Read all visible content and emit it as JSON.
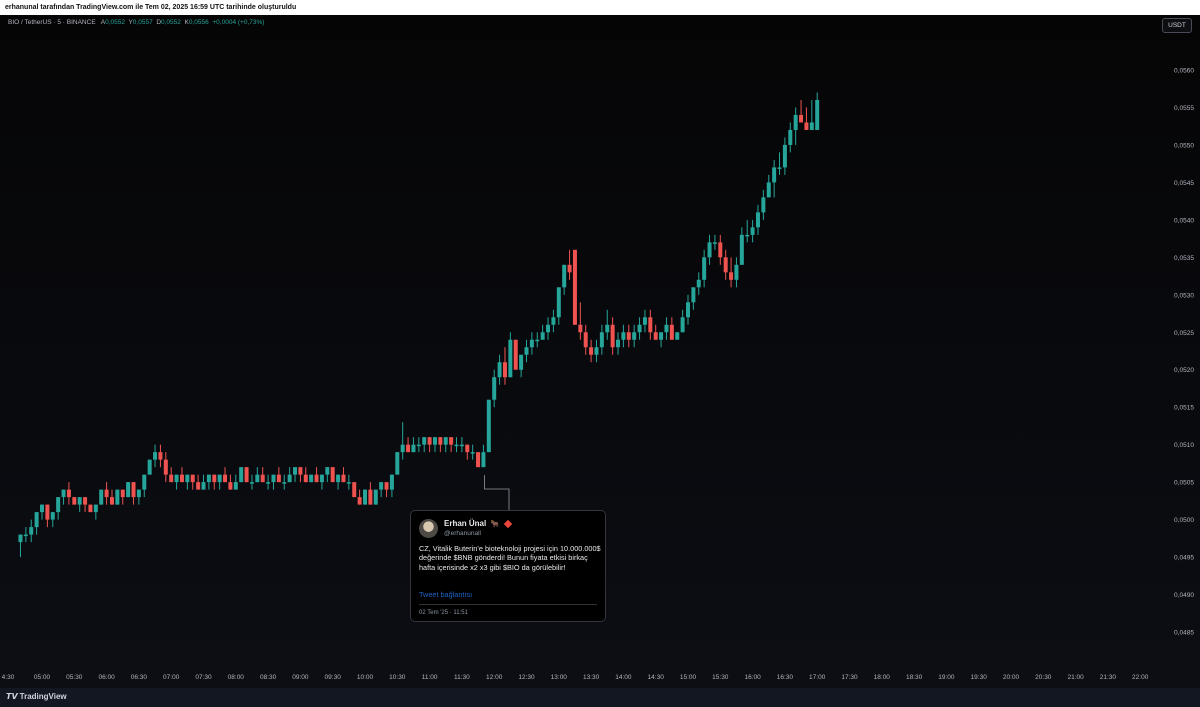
{
  "header": {
    "title": "erhanunal tarafından TradingView.com ile Tem 02, 2025 16:59 UTC tarihinde oluşturuldu"
  },
  "symbol": {
    "name": "BIO / TetherUS · 5 · BINANCE",
    "open_label": "A",
    "open": "0,0552",
    "high_label": "Y",
    "high": "0,0557",
    "low_label": "D",
    "low": "0,0552",
    "close_label": "K",
    "close": "0,0556",
    "change": "+0,0004 (+0,73%)"
  },
  "currency_button": "USDT",
  "colors": {
    "up": "#26a69a",
    "down": "#ef5350",
    "bg": "#0b0c10",
    "text": "#d1d4dc"
  },
  "price_axis": [
    "0,0560",
    "0,0555",
    "0,0550",
    "0,0545",
    "0,0540",
    "0,0535",
    "0,0530",
    "0,0525",
    "0,0520",
    "0,0515",
    "0,0510",
    "0,0505",
    "0,0500",
    "0,0495",
    "0,0490",
    "0,0485"
  ],
  "time_axis": [
    "4:30",
    "05:00",
    "05:30",
    "06:00",
    "06:30",
    "07:00",
    "07:30",
    "08:00",
    "08:30",
    "09:00",
    "09:30",
    "10:00",
    "10:30",
    "11:00",
    "11:30",
    "12:00",
    "12:30",
    "13:00",
    "13:30",
    "14:00",
    "14:30",
    "15:00",
    "15:30",
    "16:00",
    "16:30",
    "17:00",
    "17:30",
    "18:00",
    "18:30",
    "19:00",
    "19:30",
    "20:00",
    "20:30",
    "21:00",
    "21:30",
    "22:00"
  ],
  "tweet": {
    "name": "Erhan Ünal",
    "name_emoji": "🐂",
    "handle": "@erhanunall",
    "text": "CZ, Vitalik Buterin’e bioteknoloji projesi için 10.000.000$ değerinde $BNB gönderdi! Bunun fiyata etkisi birkaç hafta içerisinde x2 x3 gibi $BIO da görülebilir!",
    "link": "Tweet bağlantısı",
    "date": "02 Tem '25 · 11:51"
  },
  "footer": {
    "logo": "TradingView",
    "logo_mark": "𝙏𝙑"
  },
  "chart_data": {
    "type": "candlestick",
    "interval": "5",
    "series": [
      {
        "t": "04:40",
        "o": 0.0497,
        "h": 0.0498,
        "l": 0.0495,
        "c": 0.0498
      },
      {
        "t": "04:45",
        "o": 0.0498,
        "h": 0.0499,
        "l": 0.0497,
        "c": 0.0498
      },
      {
        "t": "04:50",
        "o": 0.0498,
        "h": 0.05,
        "l": 0.0497,
        "c": 0.0499
      },
      {
        "t": "04:55",
        "o": 0.0499,
        "h": 0.0501,
        "l": 0.0498,
        "c": 0.0501
      },
      {
        "t": "05:00",
        "o": 0.0501,
        "h": 0.0502,
        "l": 0.05,
        "c": 0.0502
      },
      {
        "t": "05:05",
        "o": 0.0502,
        "h": 0.0502,
        "l": 0.0499,
        "c": 0.05
      },
      {
        "t": "05:10",
        "o": 0.05,
        "h": 0.0501,
        "l": 0.0499,
        "c": 0.0501
      },
      {
        "t": "05:15",
        "o": 0.0501,
        "h": 0.0503,
        "l": 0.05,
        "c": 0.0503
      },
      {
        "t": "05:20",
        "o": 0.0503,
        "h": 0.0504,
        "l": 0.0502,
        "c": 0.0504
      },
      {
        "t": "05:25",
        "o": 0.0504,
        "h": 0.0505,
        "l": 0.0502,
        "c": 0.0503
      },
      {
        "t": "05:30",
        "o": 0.0503,
        "h": 0.0503,
        "l": 0.0502,
        "c": 0.0502
      },
      {
        "t": "05:35",
        "o": 0.0502,
        "h": 0.0503,
        "l": 0.0501,
        "c": 0.0503
      },
      {
        "t": "05:40",
        "o": 0.0503,
        "h": 0.0503,
        "l": 0.0501,
        "c": 0.0502
      },
      {
        "t": "05:45",
        "o": 0.0502,
        "h": 0.0502,
        "l": 0.0501,
        "c": 0.0501
      },
      {
        "t": "05:50",
        "o": 0.0501,
        "h": 0.0502,
        "l": 0.05,
        "c": 0.0502
      },
      {
        "t": "05:55",
        "o": 0.0502,
        "h": 0.0504,
        "l": 0.0502,
        "c": 0.0504
      },
      {
        "t": "06:00",
        "o": 0.0504,
        "h": 0.0505,
        "l": 0.0502,
        "c": 0.0503
      },
      {
        "t": "06:05",
        "o": 0.0503,
        "h": 0.0504,
        "l": 0.0502,
        "c": 0.0502
      },
      {
        "t": "06:10",
        "o": 0.0502,
        "h": 0.0504,
        "l": 0.0502,
        "c": 0.0504
      },
      {
        "t": "06:15",
        "o": 0.0504,
        "h": 0.0504,
        "l": 0.0502,
        "c": 0.0503
      },
      {
        "t": "06:20",
        "o": 0.0503,
        "h": 0.0505,
        "l": 0.0503,
        "c": 0.0505
      },
      {
        "t": "06:25",
        "o": 0.0505,
        "h": 0.0505,
        "l": 0.0502,
        "c": 0.0503
      },
      {
        "t": "06:30",
        "o": 0.0503,
        "h": 0.0504,
        "l": 0.0502,
        "c": 0.0504
      },
      {
        "t": "06:35",
        "o": 0.0504,
        "h": 0.0506,
        "l": 0.0503,
        "c": 0.0506
      },
      {
        "t": "06:40",
        "o": 0.0506,
        "h": 0.0508,
        "l": 0.0506,
        "c": 0.0508
      },
      {
        "t": "06:45",
        "o": 0.0508,
        "h": 0.051,
        "l": 0.0507,
        "c": 0.0509
      },
      {
        "t": "06:50",
        "o": 0.0509,
        "h": 0.051,
        "l": 0.0507,
        "c": 0.0508
      },
      {
        "t": "06:55",
        "o": 0.0508,
        "h": 0.0509,
        "l": 0.0505,
        "c": 0.0506
      },
      {
        "t": "07:00",
        "o": 0.0506,
        "h": 0.0507,
        "l": 0.0505,
        "c": 0.0505
      },
      {
        "t": "07:05",
        "o": 0.0505,
        "h": 0.0506,
        "l": 0.0504,
        "c": 0.0506
      },
      {
        "t": "07:10",
        "o": 0.0506,
        "h": 0.0507,
        "l": 0.0505,
        "c": 0.0505
      },
      {
        "t": "07:15",
        "o": 0.0505,
        "h": 0.0506,
        "l": 0.0504,
        "c": 0.0506
      },
      {
        "t": "07:20",
        "o": 0.0506,
        "h": 0.0506,
        "l": 0.0504,
        "c": 0.0505
      },
      {
        "t": "07:25",
        "o": 0.0505,
        "h": 0.0506,
        "l": 0.0504,
        "c": 0.0504
      },
      {
        "t": "07:30",
        "o": 0.0504,
        "h": 0.0506,
        "l": 0.0504,
        "c": 0.0505
      },
      {
        "t": "07:35",
        "o": 0.0505,
        "h": 0.0506,
        "l": 0.0504,
        "c": 0.0506
      },
      {
        "t": "07:40",
        "o": 0.0506,
        "h": 0.0506,
        "l": 0.0504,
        "c": 0.0505
      },
      {
        "t": "07:45",
        "o": 0.0505,
        "h": 0.0506,
        "l": 0.0504,
        "c": 0.0506
      },
      {
        "t": "07:50",
        "o": 0.0506,
        "h": 0.0507,
        "l": 0.0505,
        "c": 0.0505
      },
      {
        "t": "07:55",
        "o": 0.0505,
        "h": 0.0506,
        "l": 0.0504,
        "c": 0.0504
      },
      {
        "t": "08:00",
        "o": 0.0504,
        "h": 0.0506,
        "l": 0.0504,
        "c": 0.0505
      },
      {
        "t": "08:05",
        "o": 0.0505,
        "h": 0.0507,
        "l": 0.0505,
        "c": 0.0507
      },
      {
        "t": "08:10",
        "o": 0.0507,
        "h": 0.0507,
        "l": 0.0505,
        "c": 0.0505
      },
      {
        "t": "08:15",
        "o": 0.0505,
        "h": 0.0506,
        "l": 0.0504,
        "c": 0.0505
      },
      {
        "t": "08:20",
        "o": 0.0505,
        "h": 0.0507,
        "l": 0.0505,
        "c": 0.0506
      },
      {
        "t": "08:25",
        "o": 0.0506,
        "h": 0.0507,
        "l": 0.0505,
        "c": 0.0505
      },
      {
        "t": "08:30",
        "o": 0.0505,
        "h": 0.0506,
        "l": 0.0504,
        "c": 0.0505
      },
      {
        "t": "08:35",
        "o": 0.0505,
        "h": 0.0506,
        "l": 0.0504,
        "c": 0.0506
      },
      {
        "t": "08:40",
        "o": 0.0506,
        "h": 0.0507,
        "l": 0.0505,
        "c": 0.0505
      },
      {
        "t": "08:45",
        "o": 0.0505,
        "h": 0.0506,
        "l": 0.0504,
        "c": 0.0505
      },
      {
        "t": "08:50",
        "o": 0.0505,
        "h": 0.0507,
        "l": 0.0505,
        "c": 0.0506
      },
      {
        "t": "08:55",
        "o": 0.0506,
        "h": 0.0507,
        "l": 0.0505,
        "c": 0.0507
      },
      {
        "t": "09:00",
        "o": 0.0507,
        "h": 0.0507,
        "l": 0.0505,
        "c": 0.0506
      },
      {
        "t": "09:05",
        "o": 0.0506,
        "h": 0.0507,
        "l": 0.0505,
        "c": 0.0505
      },
      {
        "t": "09:10",
        "o": 0.0505,
        "h": 0.0506,
        "l": 0.0505,
        "c": 0.0506
      },
      {
        "t": "09:15",
        "o": 0.0506,
        "h": 0.0507,
        "l": 0.0505,
        "c": 0.0505
      },
      {
        "t": "09:20",
        "o": 0.0505,
        "h": 0.0506,
        "l": 0.0504,
        "c": 0.0506
      },
      {
        "t": "09:25",
        "o": 0.0506,
        "h": 0.0507,
        "l": 0.0505,
        "c": 0.0507
      },
      {
        "t": "09:30",
        "o": 0.0507,
        "h": 0.0507,
        "l": 0.0505,
        "c": 0.0505
      },
      {
        "t": "09:35",
        "o": 0.0505,
        "h": 0.0506,
        "l": 0.0504,
        "c": 0.0506
      },
      {
        "t": "09:40",
        "o": 0.0506,
        "h": 0.0507,
        "l": 0.0505,
        "c": 0.0505
      },
      {
        "t": "09:45",
        "o": 0.0505,
        "h": 0.0506,
        "l": 0.0504,
        "c": 0.0505
      },
      {
        "t": "09:50",
        "o": 0.0505,
        "h": 0.0505,
        "l": 0.0503,
        "c": 0.0503
      },
      {
        "t": "09:55",
        "o": 0.0503,
        "h": 0.0504,
        "l": 0.0502,
        "c": 0.0502
      },
      {
        "t": "10:00",
        "o": 0.0502,
        "h": 0.0504,
        "l": 0.0502,
        "c": 0.0504
      },
      {
        "t": "10:05",
        "o": 0.0504,
        "h": 0.0505,
        "l": 0.0502,
        "c": 0.0502
      },
      {
        "t": "10:10",
        "o": 0.0502,
        "h": 0.0504,
        "l": 0.0502,
        "c": 0.0504
      },
      {
        "t": "10:15",
        "o": 0.0504,
        "h": 0.0505,
        "l": 0.0503,
        "c": 0.0505
      },
      {
        "t": "10:20",
        "o": 0.0505,
        "h": 0.0505,
        "l": 0.0503,
        "c": 0.0504
      },
      {
        "t": "10:25",
        "o": 0.0504,
        "h": 0.0506,
        "l": 0.0503,
        "c": 0.0506
      },
      {
        "t": "10:30",
        "o": 0.0506,
        "h": 0.0509,
        "l": 0.0506,
        "c": 0.0509
      },
      {
        "t": "10:35",
        "o": 0.0509,
        "h": 0.0513,
        "l": 0.0508,
        "c": 0.051
      },
      {
        "t": "10:40",
        "o": 0.051,
        "h": 0.0511,
        "l": 0.0509,
        "c": 0.0509
      },
      {
        "t": "10:45",
        "o": 0.0509,
        "h": 0.0511,
        "l": 0.0509,
        "c": 0.051
      },
      {
        "t": "10:50",
        "o": 0.051,
        "h": 0.0511,
        "l": 0.0509,
        "c": 0.051
      },
      {
        "t": "10:55",
        "o": 0.051,
        "h": 0.0511,
        "l": 0.0509,
        "c": 0.0511
      },
      {
        "t": "11:00",
        "o": 0.0511,
        "h": 0.0511,
        "l": 0.0509,
        "c": 0.051
      },
      {
        "t": "11:05",
        "o": 0.051,
        "h": 0.0511,
        "l": 0.0509,
        "c": 0.0511
      },
      {
        "t": "11:10",
        "o": 0.0511,
        "h": 0.0511,
        "l": 0.0509,
        "c": 0.051
      },
      {
        "t": "11:15",
        "o": 0.051,
        "h": 0.0511,
        "l": 0.0509,
        "c": 0.0511
      },
      {
        "t": "11:20",
        "o": 0.0511,
        "h": 0.0511,
        "l": 0.0509,
        "c": 0.051
      },
      {
        "t": "11:25",
        "o": 0.051,
        "h": 0.0511,
        "l": 0.0509,
        "c": 0.051
      },
      {
        "t": "11:30",
        "o": 0.051,
        "h": 0.0511,
        "l": 0.0509,
        "c": 0.051
      },
      {
        "t": "11:35",
        "o": 0.051,
        "h": 0.051,
        "l": 0.0508,
        "c": 0.0509
      },
      {
        "t": "11:40",
        "o": 0.0509,
        "h": 0.051,
        "l": 0.0508,
        "c": 0.0509
      },
      {
        "t": "11:45",
        "o": 0.0509,
        "h": 0.0509,
        "l": 0.0507,
        "c": 0.0507
      },
      {
        "t": "11:50",
        "o": 0.0507,
        "h": 0.051,
        "l": 0.0507,
        "c": 0.0509
      },
      {
        "t": "11:55",
        "o": 0.0509,
        "h": 0.0516,
        "l": 0.0509,
        "c": 0.0516
      },
      {
        "t": "12:00",
        "o": 0.0516,
        "h": 0.052,
        "l": 0.0515,
        "c": 0.0519
      },
      {
        "t": "12:05",
        "o": 0.0519,
        "h": 0.0522,
        "l": 0.0518,
        "c": 0.0521
      },
      {
        "t": "12:10",
        "o": 0.0521,
        "h": 0.0523,
        "l": 0.0518,
        "c": 0.0519
      },
      {
        "t": "12:15",
        "o": 0.0519,
        "h": 0.0525,
        "l": 0.0519,
        "c": 0.0524
      },
      {
        "t": "12:20",
        "o": 0.0524,
        "h": 0.0524,
        "l": 0.052,
        "c": 0.052
      },
      {
        "t": "12:25",
        "o": 0.052,
        "h": 0.0522,
        "l": 0.0519,
        "c": 0.0522
      },
      {
        "t": "12:30",
        "o": 0.0522,
        "h": 0.0524,
        "l": 0.0521,
        "c": 0.0523
      },
      {
        "t": "12:35",
        "o": 0.0523,
        "h": 0.0525,
        "l": 0.0522,
        "c": 0.0524
      },
      {
        "t": "12:40",
        "o": 0.0524,
        "h": 0.0525,
        "l": 0.0523,
        "c": 0.0524
      },
      {
        "t": "12:45",
        "o": 0.0524,
        "h": 0.0526,
        "l": 0.0524,
        "c": 0.0525
      },
      {
        "t": "12:50",
        "o": 0.0525,
        "h": 0.0527,
        "l": 0.0524,
        "c": 0.0526
      },
      {
        "t": "12:55",
        "o": 0.0526,
        "h": 0.0528,
        "l": 0.0525,
        "c": 0.0527
      },
      {
        "t": "13:00",
        "o": 0.0527,
        "h": 0.0531,
        "l": 0.0526,
        "c": 0.0531
      },
      {
        "t": "13:05",
        "o": 0.0531,
        "h": 0.0534,
        "l": 0.053,
        "c": 0.0534
      },
      {
        "t": "13:10",
        "o": 0.0534,
        "h": 0.0536,
        "l": 0.0532,
        "c": 0.0533
      },
      {
        "t": "13:15",
        "o": 0.0536,
        "h": 0.0536,
        "l": 0.0526,
        "c": 0.0526
      },
      {
        "t": "13:20",
        "o": 0.0526,
        "h": 0.0529,
        "l": 0.0524,
        "c": 0.0525
      },
      {
        "t": "13:25",
        "o": 0.0525,
        "h": 0.0526,
        "l": 0.0522,
        "c": 0.0523
      },
      {
        "t": "13:30",
        "o": 0.0523,
        "h": 0.0524,
        "l": 0.0521,
        "c": 0.0522
      },
      {
        "t": "13:35",
        "o": 0.0522,
        "h": 0.0524,
        "l": 0.0521,
        "c": 0.0523
      },
      {
        "t": "13:40",
        "o": 0.0523,
        "h": 0.0526,
        "l": 0.0522,
        "c": 0.0525
      },
      {
        "t": "13:45",
        "o": 0.0525,
        "h": 0.0528,
        "l": 0.0524,
        "c": 0.0526
      },
      {
        "t": "13:50",
        "o": 0.0526,
        "h": 0.0527,
        "l": 0.0522,
        "c": 0.0523
      },
      {
        "t": "13:55",
        "o": 0.0523,
        "h": 0.0525,
        "l": 0.0522,
        "c": 0.0524
      },
      {
        "t": "14:00",
        "o": 0.0524,
        "h": 0.0526,
        "l": 0.0523,
        "c": 0.0525
      },
      {
        "t": "14:05",
        "o": 0.0525,
        "h": 0.0526,
        "l": 0.0523,
        "c": 0.0524
      },
      {
        "t": "14:10",
        "o": 0.0524,
        "h": 0.0526,
        "l": 0.0523,
        "c": 0.0525
      },
      {
        "t": "14:15",
        "o": 0.0525,
        "h": 0.0527,
        "l": 0.0524,
        "c": 0.0526
      },
      {
        "t": "14:20",
        "o": 0.0526,
        "h": 0.0528,
        "l": 0.0525,
        "c": 0.0527
      },
      {
        "t": "14:25",
        "o": 0.0527,
        "h": 0.0528,
        "l": 0.0524,
        "c": 0.0525
      },
      {
        "t": "14:30",
        "o": 0.0525,
        "h": 0.0526,
        "l": 0.0524,
        "c": 0.0524
      },
      {
        "t": "14:35",
        "o": 0.0524,
        "h": 0.0525,
        "l": 0.0523,
        "c": 0.0525
      },
      {
        "t": "14:40",
        "o": 0.0525,
        "h": 0.0527,
        "l": 0.0524,
        "c": 0.0526
      },
      {
        "t": "14:45",
        "o": 0.0526,
        "h": 0.0527,
        "l": 0.0524,
        "c": 0.0524
      },
      {
        "t": "14:50",
        "o": 0.0524,
        "h": 0.0525,
        "l": 0.0524,
        "c": 0.0525
      },
      {
        "t": "14:55",
        "o": 0.0525,
        "h": 0.0528,
        "l": 0.0525,
        "c": 0.0527
      },
      {
        "t": "15:00",
        "o": 0.0527,
        "h": 0.053,
        "l": 0.0526,
        "c": 0.0529
      },
      {
        "t": "15:05",
        "o": 0.0529,
        "h": 0.0531,
        "l": 0.0528,
        "c": 0.0531
      },
      {
        "t": "15:10",
        "o": 0.0531,
        "h": 0.0533,
        "l": 0.053,
        "c": 0.0532
      },
      {
        "t": "15:15",
        "o": 0.0532,
        "h": 0.0536,
        "l": 0.0531,
        "c": 0.0535
      },
      {
        "t": "15:20",
        "o": 0.0535,
        "h": 0.0538,
        "l": 0.0534,
        "c": 0.0537
      },
      {
        "t": "15:25",
        "o": 0.0537,
        "h": 0.0538,
        "l": 0.0536,
        "c": 0.0537
      },
      {
        "t": "15:30",
        "o": 0.0537,
        "h": 0.0538,
        "l": 0.0534,
        "c": 0.0535
      },
      {
        "t": "15:35",
        "o": 0.0535,
        "h": 0.0536,
        "l": 0.0532,
        "c": 0.0533
      },
      {
        "t": "15:40",
        "o": 0.0533,
        "h": 0.0535,
        "l": 0.0531,
        "c": 0.0532
      },
      {
        "t": "15:45",
        "o": 0.0532,
        "h": 0.0535,
        "l": 0.0531,
        "c": 0.0534
      },
      {
        "t": "15:50",
        "o": 0.0534,
        "h": 0.0539,
        "l": 0.0534,
        "c": 0.0538
      },
      {
        "t": "15:55",
        "o": 0.0538,
        "h": 0.054,
        "l": 0.0537,
        "c": 0.0538
      },
      {
        "t": "16:00",
        "o": 0.0538,
        "h": 0.054,
        "l": 0.0537,
        "c": 0.0539
      },
      {
        "t": "16:05",
        "o": 0.0539,
        "h": 0.0542,
        "l": 0.0538,
        "c": 0.0541
      },
      {
        "t": "16:10",
        "o": 0.0541,
        "h": 0.0544,
        "l": 0.054,
        "c": 0.0543
      },
      {
        "t": "16:15",
        "o": 0.0543,
        "h": 0.0546,
        "l": 0.0543,
        "c": 0.0545
      },
      {
        "t": "16:20",
        "o": 0.0545,
        "h": 0.0548,
        "l": 0.0543,
        "c": 0.0547
      },
      {
        "t": "16:25",
        "o": 0.0547,
        "h": 0.0549,
        "l": 0.0546,
        "c": 0.0547
      },
      {
        "t": "16:30",
        "o": 0.0547,
        "h": 0.0551,
        "l": 0.0546,
        "c": 0.055
      },
      {
        "t": "16:35",
        "o": 0.055,
        "h": 0.0553,
        "l": 0.0549,
        "c": 0.0552
      },
      {
        "t": "16:40",
        "o": 0.0552,
        "h": 0.0555,
        "l": 0.055,
        "c": 0.0554
      },
      {
        "t": "16:45",
        "o": 0.0554,
        "h": 0.0556,
        "l": 0.0553,
        "c": 0.0553
      },
      {
        "t": "16:50",
        "o": 0.0553,
        "h": 0.0555,
        "l": 0.0552,
        "c": 0.0552
      },
      {
        "t": "16:55",
        "o": 0.0552,
        "h": 0.0556,
        "l": 0.0552,
        "c": 0.0553
      },
      {
        "t": "17:00",
        "o": 0.0552,
        "h": 0.0557,
        "l": 0.0552,
        "c": 0.0556
      }
    ]
  }
}
